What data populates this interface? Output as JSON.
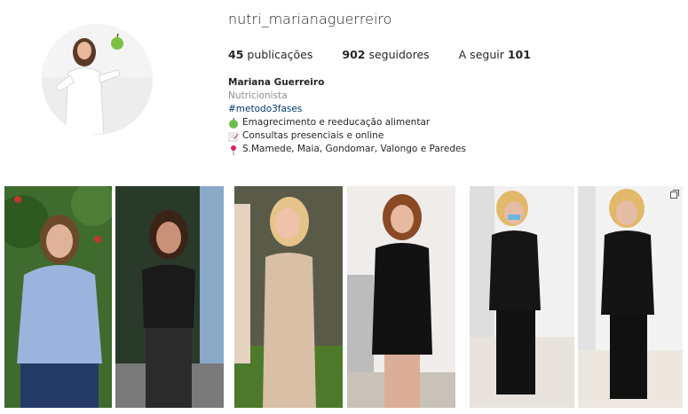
{
  "profile": {
    "username": "nutri_marianaguerreiro",
    "stats": {
      "posts_count": "45",
      "posts_label": "publicações",
      "followers_count": "902",
      "followers_label": "seguidores",
      "following_label": "A seguir",
      "following_count": "101"
    },
    "bio": {
      "name": "Mariana Guerreiro",
      "category": "Nutricionista",
      "hashtag": "#metodo3fases",
      "line1": {
        "icon": "green-apple-icon",
        "text": "Emagrecimento e reeducação alimentar"
      },
      "line2": {
        "icon": "memo-icon",
        "text": "Consultas presenciais e online"
      },
      "line3": {
        "icon": "round-pushpin-icon",
        "text": "S.Mamede, Maia, Gondomar, Valongo e Paredes"
      }
    }
  },
  "posts": [
    {
      "icon": "post-photo"
    },
    {
      "icon": "post-photo"
    },
    {
      "icon": "post-photo"
    },
    {
      "icon": "post-photo"
    },
    {
      "icon": "post-photo"
    },
    {
      "icon": "post-photo",
      "badge": "multiple-photos-icon"
    }
  ],
  "colors": {
    "link": "#00376b",
    "muted": "#8e8e8e",
    "text": "#262626"
  }
}
